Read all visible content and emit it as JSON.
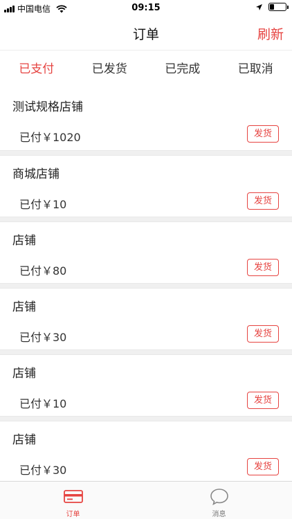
{
  "status_bar": {
    "carrier": "中国电信",
    "time": "09:15",
    "battery_level": 0.25
  },
  "nav": {
    "title": "订单",
    "refresh_label": "刷新"
  },
  "tabs": [
    {
      "label": "已支付",
      "active": true
    },
    {
      "label": "已发货",
      "active": false
    },
    {
      "label": "已完成",
      "active": false
    },
    {
      "label": "已取消",
      "active": false
    }
  ],
  "orders": [
    {
      "shop": "测试规格店铺",
      "amount": "已付￥1020",
      "action": "发货"
    },
    {
      "shop": "商城店铺",
      "amount": "已付￥10",
      "action": "发货"
    },
    {
      "shop": "店铺",
      "amount": "已付￥80",
      "action": "发货"
    },
    {
      "shop": "店铺",
      "amount": "已付￥30",
      "action": "发货"
    },
    {
      "shop": "店铺",
      "amount": "已付￥10",
      "action": "发货"
    },
    {
      "shop": "店铺",
      "amount": "已付￥30",
      "action": "发货"
    }
  ],
  "tabbar": [
    {
      "label": "订单",
      "icon": "card-icon",
      "active": true
    },
    {
      "label": "消息",
      "icon": "chat-bubble-icon",
      "active": false
    }
  ],
  "colors": {
    "accent": "#e64340",
    "background": "#f0f0f0"
  }
}
